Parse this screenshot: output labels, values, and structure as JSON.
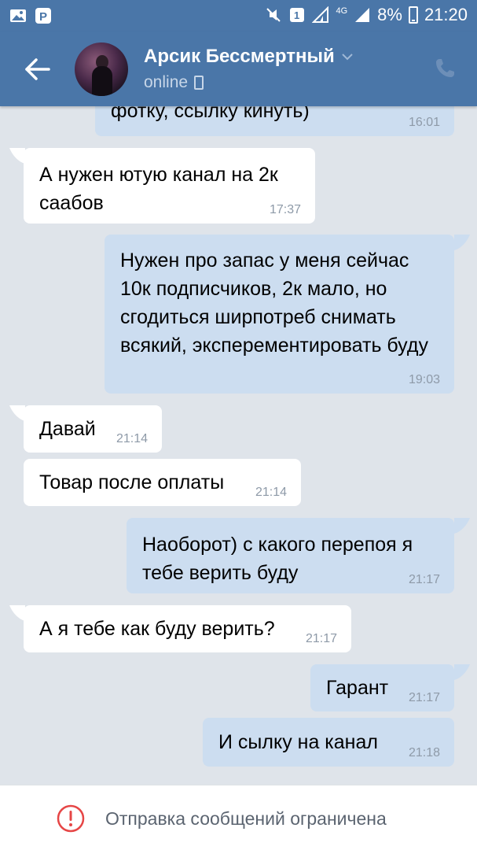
{
  "status_bar": {
    "network": "4G",
    "sim_badge": "1",
    "battery": "8%",
    "time": "21:20"
  },
  "header": {
    "contact_name": "Арсик Бессмертный",
    "status": "online"
  },
  "messages": [
    {
      "direction": "out",
      "text": "фотку, ссылку кинуть)",
      "time": "16:01"
    },
    {
      "direction": "in",
      "text": "А нужен ютую канал на 2к саабов",
      "time": "17:37"
    },
    {
      "direction": "out",
      "text": "Нужен про запас у меня  сейчас 10к подписчиков, 2к мало, но сгодиться ширпотреб снимать всякий, эксперементировать буду",
      "time": "19:03"
    },
    {
      "direction": "in",
      "text": "Давай",
      "time": "21:14"
    },
    {
      "direction": "in",
      "text": "Товар после оплаты",
      "time": "21:14"
    },
    {
      "direction": "out",
      "text": "Наоборот) с какого перепоя я тебе верить буду",
      "time": "21:17"
    },
    {
      "direction": "in",
      "text": "А я тебе как буду верить?",
      "time": "21:17"
    },
    {
      "direction": "out",
      "text": "Гарант",
      "time": "21:17"
    },
    {
      "direction": "out",
      "text": "И сылку на канал",
      "time": "21:18"
    }
  ],
  "footer": {
    "notice": "Отправка сообщений ограничена"
  },
  "colors": {
    "header_bg": "#4a76a8",
    "chat_bg": "#dfe4ea",
    "incoming_bubble": "#ffffff",
    "outgoing_bubble": "#ccddf0",
    "warning": "#e64646"
  }
}
